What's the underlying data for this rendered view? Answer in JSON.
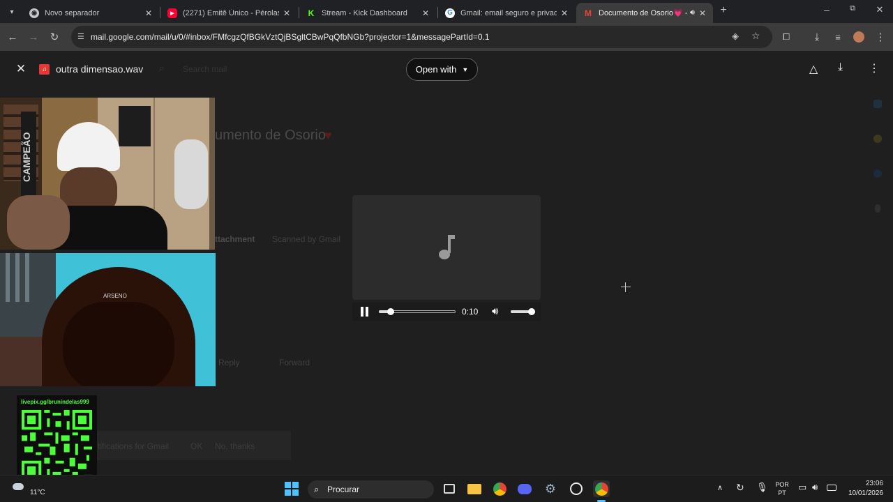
{
  "browser": {
    "tabs": [
      {
        "title": "Novo separador",
        "icon": "chrome-icon",
        "active": false
      },
      {
        "title": "(2271) Emitê Único - Pérolas (O",
        "icon": "youtube-icon",
        "active": false
      },
      {
        "title": "Stream - Kick Dashboard",
        "icon": "kick-icon",
        "active": false
      },
      {
        "title": "Gmail: email seguro e privado s",
        "icon": "google-icon",
        "active": false
      },
      {
        "title": "Documento de Osorio💗 - ",
        "icon": "gmail-icon",
        "active": true
      }
    ],
    "new_tab_label": "+",
    "url": "mail.google.com/mail/u/0/#inbox/FMfcgzQfBGkVztQjBSgltCBwPqQfbNGb?projector=1&messagePartId=0.1"
  },
  "viewer": {
    "file_name": "outra dimensao.wav",
    "open_with_label": "Open with",
    "search_placeholder": "Search mail"
  },
  "player": {
    "time": "0:10",
    "progress": 0.15,
    "volume": 0.85,
    "state": "playing"
  },
  "gmail_background": {
    "subject": "umento de Osorio",
    "attachment_label": "ttachment",
    "scanned_label": "Scanned by Gmail",
    "reply_label": "Reply",
    "forward_label": "Forward",
    "notification_text": "tifications for Gmail",
    "ok_label": "OK",
    "no_thanks_label": "No, thanks"
  },
  "overlay": {
    "qr_url": "livepix.gg/brunindelas999"
  },
  "taskbar": {
    "search_label": "Procurar",
    "weather_temp": "11°C",
    "lang_line1": "POR",
    "lang_line2": "PT",
    "time": "23:06",
    "date": "10/01/2026"
  }
}
